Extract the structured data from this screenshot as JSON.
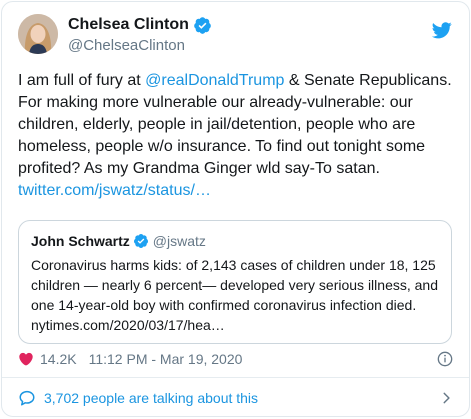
{
  "author": {
    "display_name": "Chelsea Clinton",
    "handle": "@ChelseaClinton"
  },
  "tweet": {
    "text_parts": [
      {
        "text": "I am full of fury at ",
        "link": false
      },
      {
        "text": "@realDonaldTrump",
        "link": true
      },
      {
        "text": " & Senate Republicans. For making more vulnerable our already-vulnerable: our children, elderly, people in jail/detention, people who are homeless, people w/o insurance. To find out tonight some profited? As my Grandma Ginger wld say-To satan. ",
        "link": false
      },
      {
        "text": "twitter.com/jswatz/status/…",
        "link": true
      }
    ]
  },
  "quoted": {
    "display_name": "John Schwartz",
    "handle": "@jswatz",
    "text": "Coronavirus harms kids: of  2,143 cases of children under 18, 125 children — nearly 6 percent— developed very serious illness, and one 14-year-old boy with confirmed coronavirus infection died. nytimes.com/2020/03/17/hea…"
  },
  "meta": {
    "likes": "14.2K",
    "timestamp": "11:12 PM - Mar 19, 2020"
  },
  "footer": {
    "conversation_text": "3,702 people are talking about this"
  },
  "icons": {
    "verified": "verified-badge-icon",
    "brand": "twitter-bird-icon",
    "like": "heart-icon",
    "info": "info-icon",
    "conversation": "speech-bubble-icon",
    "chevron": "chevron-right-icon"
  },
  "colors": {
    "link": "#1b95e0",
    "muted": "#657786",
    "heart": "#e0245e",
    "border": "#e1e8ed"
  }
}
